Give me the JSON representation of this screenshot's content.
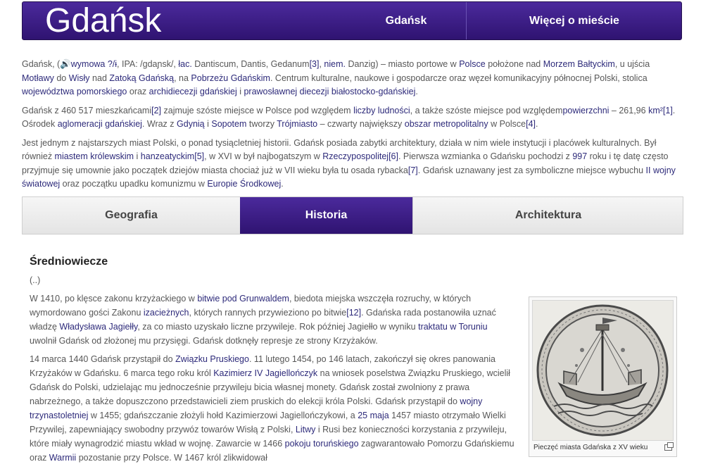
{
  "header": {
    "title": "Gdańsk",
    "nav": [
      "Gdańsk",
      "Więcej o mieście"
    ]
  },
  "intro": {
    "p1": [
      {
        "t": "Gdańsk, ("
      },
      {
        "t": "🔊wymowa ?/ɨ",
        "link": true
      },
      {
        "t": ", IPA: /gdaɲsk/, "
      },
      {
        "t": "łac.",
        "link": true
      },
      {
        "t": " Dantiscum, Dantis, Gedanum"
      },
      {
        "t": "[3]",
        "link": true
      },
      {
        "t": ", "
      },
      {
        "t": "niem.",
        "link": true
      },
      {
        "t": " Danzig) – miasto portowe w "
      },
      {
        "t": "Polsce",
        "link": true
      },
      {
        "t": " położone nad "
      },
      {
        "t": "Morzem Bałtyckim",
        "link": true
      },
      {
        "t": ", u ujścia "
      },
      {
        "t": "Motławy",
        "link": true
      },
      {
        "t": " do "
      },
      {
        "t": "Wisły",
        "link": true
      },
      {
        "t": " nad "
      },
      {
        "t": "Zatoką Gdańską",
        "link": true
      },
      {
        "t": ", na "
      },
      {
        "t": "Pobrzeżu Gdańskim",
        "link": true
      },
      {
        "t": ". Centrum kulturalne, naukowe i gospodarcze oraz węzeł komunikacyjny północnej Polski, stolica "
      },
      {
        "t": "województwa pomorskiego",
        "link": true
      },
      {
        "t": " oraz "
      },
      {
        "t": "archidiecezji gdańskiej",
        "link": true
      },
      {
        "t": " i "
      },
      {
        "t": "prawosławnej diecezji białostocko-gdańskiej",
        "link": true
      },
      {
        "t": "."
      }
    ],
    "p2": [
      {
        "t": "Gdańsk z 460 517 mieszkańcami"
      },
      {
        "t": "[2]",
        "link": true
      },
      {
        "t": " zajmuje szóste miejsce w Polsce pod względem "
      },
      {
        "t": "liczby ludności",
        "link": true
      },
      {
        "t": ", a także szóste miejsce pod względem"
      },
      {
        "t": "powierzchni",
        "link": true
      },
      {
        "t": " – 261,96 "
      },
      {
        "t": "km²",
        "link": true
      },
      {
        "t": "[1]",
        "link": true
      },
      {
        "t": ". Ośrodek "
      },
      {
        "t": "aglomeracji gdańskiej",
        "link": true
      },
      {
        "t": ". Wraz z "
      },
      {
        "t": "Gdynią",
        "link": true
      },
      {
        "t": " i "
      },
      {
        "t": "Sopotem",
        "link": true
      },
      {
        "t": " tworzy "
      },
      {
        "t": "Trójmiasto",
        "link": true
      },
      {
        "t": " – czwarty największy "
      },
      {
        "t": "obszar metropolitalny",
        "link": true
      },
      {
        "t": " w Polsce"
      },
      {
        "t": "[4]",
        "link": true
      },
      {
        "t": "."
      }
    ],
    "p3": [
      {
        "t": "Jest jednym z najstarszych miast Polski, o ponad tysiącletniej historii. Gdańsk posiada zabytki architektury, działa w nim wiele instytucji i placówek kulturalnych. Był również "
      },
      {
        "t": "miastem królewskim",
        "link": true
      },
      {
        "t": " i "
      },
      {
        "t": "hanzeatyckim",
        "link": true
      },
      {
        "t": "[5]",
        "link": true
      },
      {
        "t": ", w XVI w był najbogatszym w "
      },
      {
        "t": "Rzeczypospolitej",
        "link": true
      },
      {
        "t": "[6]",
        "link": true
      },
      {
        "t": ". Pierwsza wzmianka o Gdańsku pochodzi z "
      },
      {
        "t": "997",
        "link": true
      },
      {
        "t": " roku i tę datę często przyjmuje się umownie jako początek dziejów miasta chociaż już w VII wieku była tu osada rybacka"
      },
      {
        "t": "[7]",
        "link": true
      },
      {
        "t": ". Gdańsk uznawany jest za symboliczne miejsce wybuchu "
      },
      {
        "t": "II wojny światowej",
        "link": true
      },
      {
        "t": " oraz początku upadku komunizmu w "
      },
      {
        "t": "Europie Środkowej",
        "link": true
      },
      {
        "t": "."
      }
    ]
  },
  "tabs": [
    "Geografia",
    "Historia",
    "Architektura"
  ],
  "section": {
    "title": "Średniowiecze",
    "ellipsis": "(..)",
    "p1": [
      {
        "t": "W 1410, po klęsce zakonu krzyżackiego w "
      },
      {
        "t": "bitwie pod Grunwaldem",
        "link": true
      },
      {
        "t": ", biedota miejska wszczęła rozruchy, w których wymordowano gości Zakonu "
      },
      {
        "t": "izacieżnych",
        "link": true
      },
      {
        "t": ", których rannych przywieziono po bitwie"
      },
      {
        "t": "[12]",
        "link": true
      },
      {
        "t": ". Gdańska rada postanowiła uznać władzę "
      },
      {
        "t": "Władysława Jagiełły",
        "link": true
      },
      {
        "t": ", za co miasto uzyskało liczne przywileje. Rok później Jagiełło w wyniku "
      },
      {
        "t": "traktatu w Toruniu",
        "link": true
      },
      {
        "t": " uwolnił Gdańsk od złożonej mu przysięgi. Gdańsk dotknęły represje ze strony Krzyżaków."
      }
    ],
    "p2": [
      {
        "t": "14 marca 1440 Gdańsk przystąpił do "
      },
      {
        "t": "Związku Pruskiego",
        "link": true
      },
      {
        "t": ". 11 lutego 1454, po 146 latach, zakończył się okres panowania Krzyżaków w Gdańsku. 6 marca tego roku król "
      },
      {
        "t": "Kazimierz IV Jagiellończyk",
        "link": true
      },
      {
        "t": " na wniosek poselstwa Związku Pruskiego, wcielił Gdańsk do Polski, udzielając mu jednocześnie przywileju bicia własnej monety. Gdańsk został zwolniony z prawa nabrzeżnego, a także dopuszczono przedstawicieli ziem pruskich do elekcji króla Polski. Gdańsk przystąpił do "
      },
      {
        "t": "wojny trzynastoletniej",
        "link": true
      },
      {
        "t": " w 1455; gdańszczanie złożyli hołd Kazimierzowi Jagiellończykowi, a "
      },
      {
        "t": "25 maja",
        "link": true
      },
      {
        "t": " 1457 miasto otrzymało Wielki Przywilej, zapewniający swobodny przywóz towarów Wisłą z Polski, "
      },
      {
        "t": "Litwy",
        "link": true
      },
      {
        "t": " i Rusi bez konieczności korzystania z przywileju, które miały wynagrodzić miastu wkład w wojnę. Zawarcie w 1466 "
      },
      {
        "t": "pokoju toruńskiego",
        "link": true
      },
      {
        "t": " zagwarantowało Pomorzu Gdańskiemu oraz "
      },
      {
        "t": "Warmii",
        "link": true
      },
      {
        "t": " pozostanie przy Polsce. W 1467 król zlikwidował"
      }
    ]
  },
  "figure": {
    "caption": "Pieczęć miasta Gdańska z XV wieku"
  }
}
